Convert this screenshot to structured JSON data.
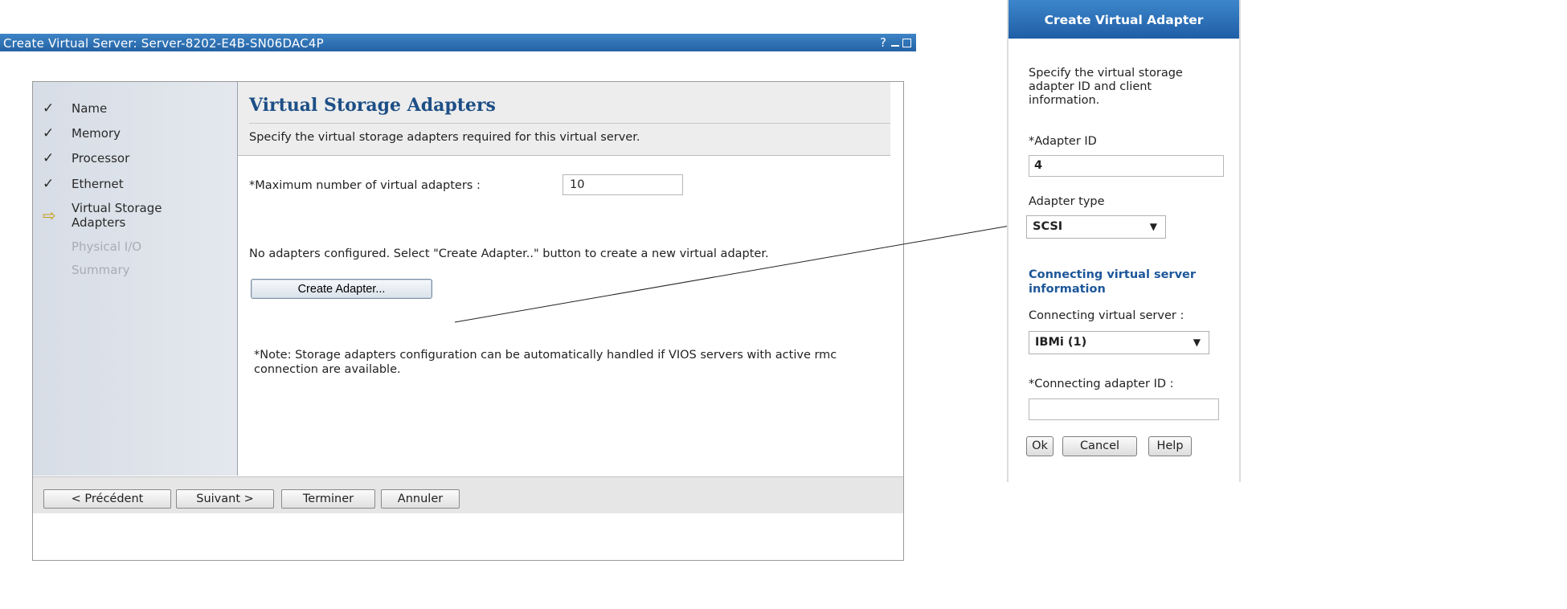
{
  "window": {
    "title": "Create Virtual Server: Server-8202-E4B-SN06DAC4P",
    "controls": {
      "help": "?"
    }
  },
  "steps": [
    {
      "label": "Name",
      "state": "done",
      "icon": "check-icon"
    },
    {
      "label": "Memory",
      "state": "done",
      "icon": "check-icon"
    },
    {
      "label": "Processor",
      "state": "done",
      "icon": "check-icon"
    },
    {
      "label": "Ethernet",
      "state": "done",
      "icon": "check-icon"
    },
    {
      "label": "Virtual Storage Adapters",
      "state": "current",
      "icon": "arrow-right-icon"
    },
    {
      "label": "Physical I/O",
      "state": "pending"
    },
    {
      "label": "Summary",
      "state": "pending"
    }
  ],
  "page": {
    "title": "Virtual Storage Adapters",
    "subtitle": "Specify the virtual storage adapters required for this virtual server.",
    "max_adapters_label": "*Maximum number of virtual adapters :",
    "max_adapters_value": "10",
    "no_adapters_text": "No adapters configured. Select \"Create Adapter..\" button to create a new virtual adapter.",
    "create_button": "Create Adapter...",
    "note": "*Note: Storage adapters configuration can be automatically handled if VIOS servers with active rmc connection are available."
  },
  "footer": {
    "previous": "< Précédent",
    "next": "Suivant >",
    "finish": "Terminer",
    "cancel": "Annuler"
  },
  "dialog": {
    "title": "Create Virtual Adapter",
    "intro": "Specify the virtual storage adapter ID and client information.",
    "adapter_id_label": "*Adapter ID",
    "adapter_id_value": "4",
    "adapter_type_label": "Adapter type",
    "adapter_type_value": "SCSI",
    "connecting_header": "Connecting virtual server information",
    "connecting_server_label": "Connecting virtual server :",
    "connecting_server_value": "IBMi (1)",
    "connecting_adapter_label": "*Connecting adapter ID :",
    "connecting_adapter_value": "",
    "ok": "Ok",
    "cancel": "Cancel",
    "help": "Help"
  },
  "colors": {
    "titlebar": "#2f74b8",
    "heading": "#1d4f86",
    "current_step_arrow": "#c49a10",
    "link_header": "#1d5799"
  }
}
